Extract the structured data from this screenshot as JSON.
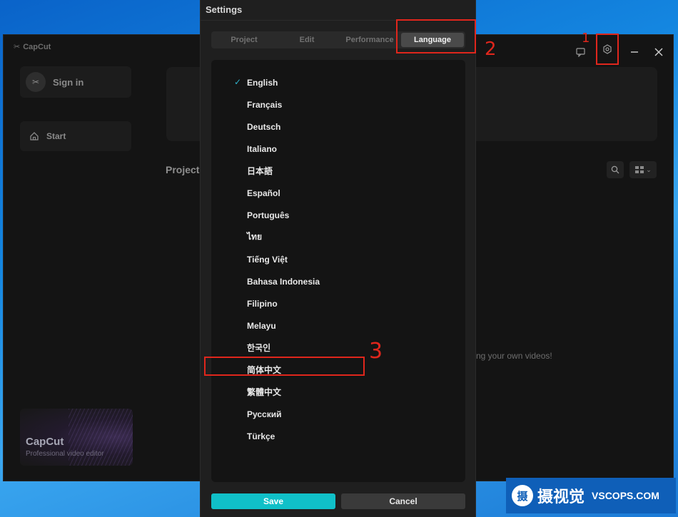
{
  "app": {
    "logo_text": "CapCut",
    "sign_in_label": "Sign in",
    "start_label": "Start",
    "projects_title": "Projects",
    "empty_text": "ng your own videos!",
    "promo_title": "CapCut",
    "promo_subtitle": "Professional video editor"
  },
  "dialog": {
    "title": "Settings",
    "tabs": [
      {
        "label": "Project",
        "active": false
      },
      {
        "label": "Edit",
        "active": false
      },
      {
        "label": "Performance",
        "active": false
      },
      {
        "label": "Language",
        "active": true
      }
    ],
    "languages": [
      {
        "label": "English",
        "selected": true
      },
      {
        "label": "Français",
        "selected": false
      },
      {
        "label": "Deutsch",
        "selected": false
      },
      {
        "label": "Italiano",
        "selected": false
      },
      {
        "label": "日本語",
        "selected": false
      },
      {
        "label": "Español",
        "selected": false
      },
      {
        "label": "Português",
        "selected": false
      },
      {
        "label": "ไทย",
        "selected": false
      },
      {
        "label": "Tiếng Việt",
        "selected": false
      },
      {
        "label": "Bahasa Indonesia",
        "selected": false
      },
      {
        "label": "Filipino",
        "selected": false
      },
      {
        "label": "Melayu",
        "selected": false
      },
      {
        "label": "한국인",
        "selected": false
      },
      {
        "label": "简体中文",
        "selected": false
      },
      {
        "label": "繁體中文",
        "selected": false
      },
      {
        "label": "Русский",
        "selected": false
      },
      {
        "label": "Türkçe",
        "selected": false
      }
    ],
    "save_label": "Save",
    "cancel_label": "Cancel"
  },
  "annotations": {
    "n1": "1",
    "n2": "2",
    "n3": "3"
  },
  "watermark": {
    "logo_char": "摄",
    "cn_text": "摄视觉",
    "en_text": "VSCOPS.COM"
  },
  "colors": {
    "accent": "#10c0c8",
    "check": "#2fb0c8",
    "annotation": "#e0261c"
  }
}
